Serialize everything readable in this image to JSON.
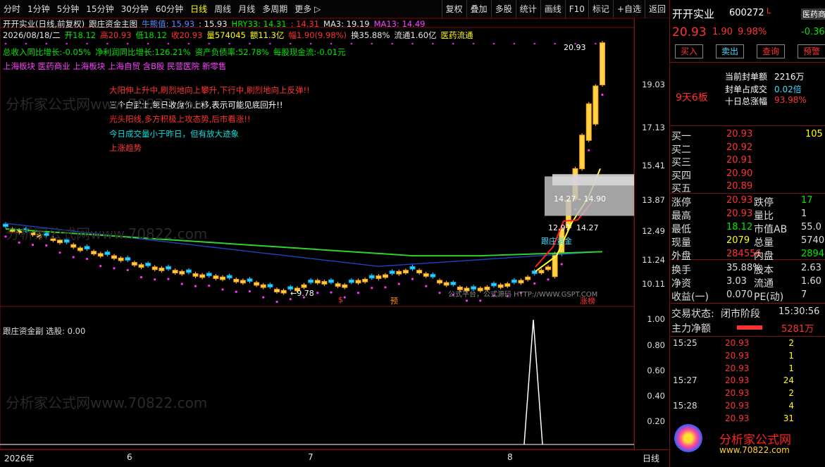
{
  "toolbar": {
    "left": [
      "分时",
      "1分钟",
      "5分钟",
      "15分钟",
      "30分钟",
      "60分钟",
      "日线",
      "周线",
      "月线",
      "多周期",
      "更多 ▷"
    ],
    "right": [
      "复权",
      "叠加",
      "多股",
      "统计",
      "画线",
      "F10",
      "标记",
      "+自选",
      "返回"
    ]
  },
  "info": {
    "stock": "开开实业(日线,前复权)",
    "main_ind": "跟庄资金主图",
    "niu": "牛熊值: 15.93",
    "niu2": ": 15.93",
    "hry": "HRY33: 14.31",
    "x": ": 14.31",
    "ma3": "MA3: 19.19",
    "ma13": "MA13: 14.49",
    "date": "2026/08/18/二",
    "open": "开18.12",
    "high": "高20.93",
    "low": "低18.12",
    "close": "收20.93",
    "vol": "量574045",
    "amt": "额11.3亿",
    "chg": "幅1.90(9.98%)",
    "turn": "换35.88%",
    "float": "流通1.60亿",
    "sector": "医药流通",
    "l3a": "总收入同比增长:-0.05%",
    "l3b": "净利润同比增长:126.21%",
    "l3c": "资产负债率:52.78%",
    "l3d": "每股现金流:-0.01元",
    "l4": "上海板块 医药商业 上海板块 上海自贸 含B股 民营医院 新零售"
  },
  "annotations": [
    {
      "text": "大阳伸上升中,刷烈地向上攀升,下行中,刷烈地向上反弹!!",
      "color": "#ff3232"
    },
    {
      "text": "三个白武士,每日收盘价上移,表示可能见底回升!!",
      "color": "#ffffff"
    },
    {
      "text": "光头阳线,多方积极上攻态势,后市看涨!!",
      "color": "#ff3232"
    },
    {
      "text": "今日成交量小于昨日，但有放大迹象",
      "color": "#00e0e0"
    },
    {
      "text": "上涨趋势",
      "color": "#ff3232"
    }
  ],
  "chart_labels": {
    "high": "20.93",
    "low": "←9.78",
    "box": "14.27 - 14.90",
    "b1": "12.97",
    "b2": "14.27",
    "gz": "跟庄资金",
    "sig1": "$",
    "sig2": "预",
    "sig3": "涨榜",
    "wm": "公式平台，公式源码 HTTP://WWW.GSPT.COM"
  },
  "price_axis": [
    "19.03",
    "17.13",
    "15.41",
    "13.87",
    "12.49",
    "11.24",
    "10.11"
  ],
  "sub": {
    "title": "跟庄资金副",
    "select": "选股: 0.00",
    "axis": [
      "1.00",
      "0.80",
      "0.60",
      "0.40",
      "0.20"
    ]
  },
  "bottom": {
    "year": "2026年",
    "m6": "6",
    "m7": "7",
    "m8": "8",
    "period": "日线"
  },
  "panel": {
    "name": "开开实业",
    "code": "600272",
    "tag": "L",
    "sector": "医药商",
    "price": "20.93",
    "chg": "1.90",
    "pct": "9.98%",
    "side": "-0.36",
    "buttons": [
      "买入",
      "卖出",
      "查询",
      "预警"
    ],
    "lb_label": "9天6板",
    "seal_amt_label": "当前封单额",
    "seal_amt": "2216万",
    "seal_ratio_label": "封单占成交",
    "seal_ratio": "0.02倍",
    "ten_label": "十日总涨幅",
    "ten": "93.98%",
    "bids": [
      {
        "label": "买一",
        "price": "20.93",
        "vol": "105"
      },
      {
        "label": "买二",
        "price": "20.92",
        "vol": ""
      },
      {
        "label": "买三",
        "price": "20.91",
        "vol": ""
      },
      {
        "label": "买四",
        "price": "20.90",
        "vol": ""
      },
      {
        "label": "买五",
        "price": "20.89",
        "vol": ""
      }
    ],
    "stats": [
      {
        "l1": "涨停",
        "v1": "20.93",
        "l2": "跌停",
        "v2": "17"
      },
      {
        "l1": "最高",
        "v1": "20.93",
        "l2": "量比",
        "v2": "1"
      },
      {
        "l1": "最低",
        "v1": "18.12",
        "l2": "市值AB",
        "v2": "55.0"
      },
      {
        "l1": "现量",
        "v1": "2079",
        "l2": "总量",
        "v2": "5740"
      },
      {
        "l1": "外盘",
        "v1": "284556",
        "l2": "内盘",
        "v2": "2894"
      }
    ],
    "stats2": [
      {
        "l1": "换手",
        "v1": "35.88%",
        "l2": "股本",
        "v2": "2.63"
      },
      {
        "l1": "净资",
        "v1": "3.03",
        "l2": "流通",
        "v2": "1.60"
      },
      {
        "l1": "收益(一)",
        "v1": "0.070",
        "l2": "PE(动)",
        "v2": "7"
      }
    ],
    "status_label": "交易状态:",
    "status": "闭市阶段",
    "time": "15:30:56",
    "flow_label": "主力净额",
    "flow": "5281万",
    "trades": [
      {
        "t": "15:25",
        "p": "20.93",
        "v": "2"
      },
      {
        "t": "",
        "p": "20.93",
        "v": "1"
      },
      {
        "t": "",
        "p": "20.93",
        "v": "1"
      },
      {
        "t": "15:27",
        "p": "20.93",
        "v": "24"
      },
      {
        "t": "",
        "p": "20.93",
        "v": "2"
      },
      {
        "t": "15:28",
        "p": "20.93",
        "v": "4"
      },
      {
        "t": "",
        "p": "20.93",
        "v": "31"
      }
    ],
    "logo1": "分析家公式网",
    "logo2": "www.70822.com"
  },
  "watermark": "分析家公式网www.70822.com"
}
